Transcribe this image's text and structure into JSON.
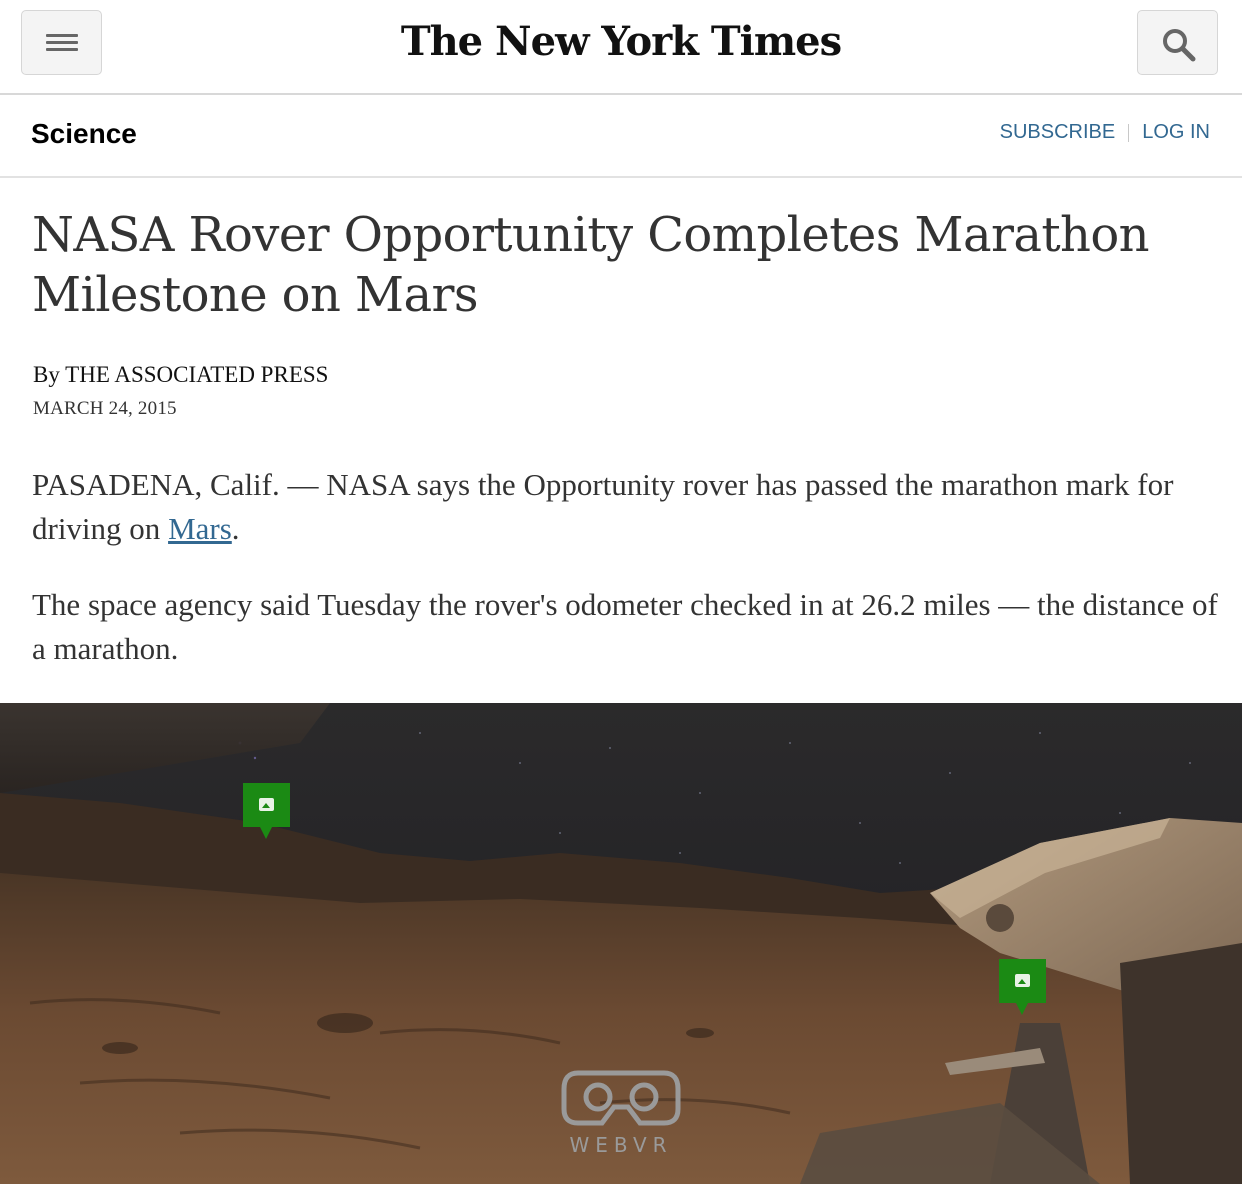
{
  "header": {
    "logo_text": "The New York Times",
    "menu_icon": "hamburger-menu-icon",
    "search_icon": "magnifier-search-icon"
  },
  "section_bar": {
    "section": "Science",
    "subscribe": "SUBSCRIBE",
    "login": "LOG IN"
  },
  "article": {
    "headline": "NASA Rover Opportunity Completes Marathon Milestone on Mars",
    "byline": "By THE ASSOCIATED PRESS",
    "date": "MARCH 24, 2015",
    "p1_before": "PASADENA, Calif. — NASA says the Opportunity rover has passed the marathon mark for driving on ",
    "p1_link": "Mars",
    "p1_after": ".",
    "p2": "The space agency said Tuesday the rover's odometer checked in at 26.2 miles — the distance of a marathon."
  },
  "vr_viewer": {
    "hotspot_icon": "image-hotspot-icon",
    "webvr_label": "WEBVR",
    "webvr_icon": "vr-goggles-icon"
  },
  "colors": {
    "link": "#326891",
    "hotspot": "#1b8a14"
  }
}
